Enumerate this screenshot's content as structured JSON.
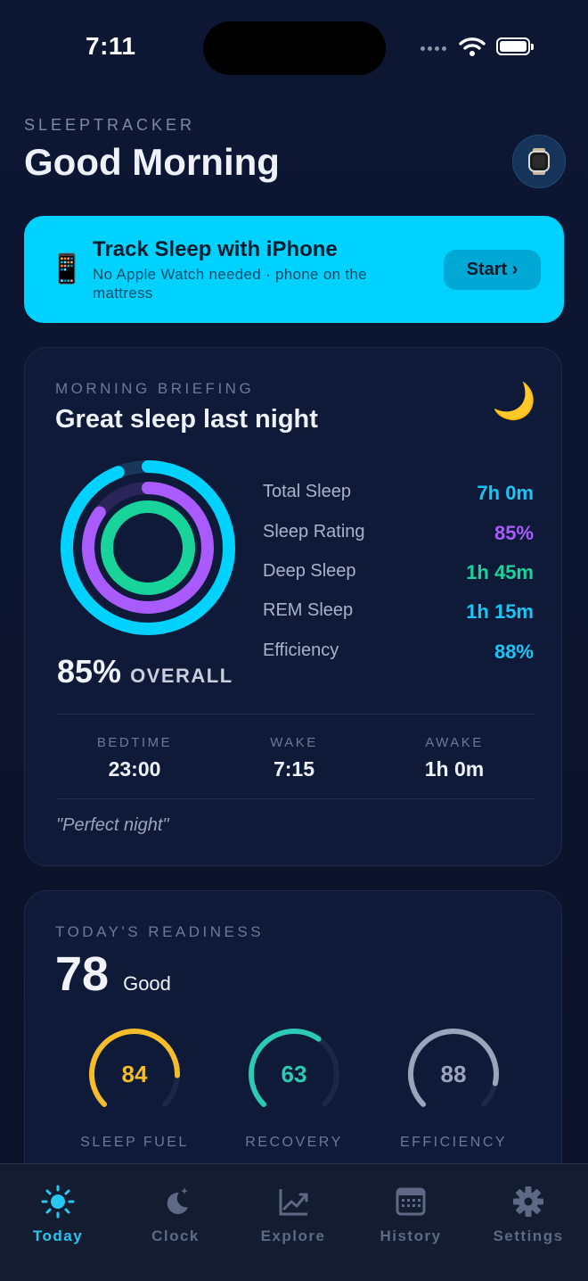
{
  "status_bar": {
    "time": "7:11"
  },
  "header": {
    "app_name": "SLEEPTRACKER",
    "greeting": "Good Morning"
  },
  "promo": {
    "title": "Track Sleep with iPhone",
    "subtitle": "No Apple Watch needed · phone on the mattress",
    "button": "Start ›"
  },
  "briefing": {
    "label": "MORNING BRIEFING",
    "title": "Great sleep last night",
    "overall_pct": "85%",
    "overall_label": "OVERALL",
    "stats": [
      {
        "name": "Total Sleep",
        "value": "7h 0m",
        "color": "#19c6f5"
      },
      {
        "name": "Sleep Rating",
        "value": "85%",
        "color": "#a95bff"
      },
      {
        "name": "Deep Sleep",
        "value": "1h 45m",
        "color": "#19d49a"
      },
      {
        "name": "REM Sleep",
        "value": "1h 15m",
        "color": "#19c6f5"
      },
      {
        "name": "Efficiency",
        "value": "88%",
        "color": "#19c6f5"
      }
    ],
    "times": [
      {
        "label": "BEDTIME",
        "value": "23:00"
      },
      {
        "label": "WAKE",
        "value": "7:15"
      },
      {
        "label": "AWAKE",
        "value": "1h 0m"
      }
    ],
    "quote": "\"Perfect night\"",
    "rings": [
      {
        "name": "outer",
        "fraction": 0.94,
        "color": "#00d2ff"
      },
      {
        "name": "middle",
        "fraction": 0.85,
        "color": "#a95bff"
      },
      {
        "name": "inner",
        "fraction": 1.0,
        "color": "#19d49a"
      }
    ]
  },
  "readiness": {
    "label": "TODAY'S READINESS",
    "score": "78",
    "rating": "Good",
    "gauges": [
      {
        "value": "84",
        "label": "SLEEP FUEL",
        "fraction": 0.84,
        "color": "#f5bd2a"
      },
      {
        "value": "63",
        "label": "RECOVERY",
        "fraction": 0.63,
        "color": "#2cc9b5"
      },
      {
        "value": "88",
        "label": "EFFICIENCY",
        "fraction": 0.88,
        "color": "#9aa5bb"
      }
    ]
  },
  "tabs": [
    {
      "label": "Today",
      "icon": "sun-icon",
      "active": true
    },
    {
      "label": "Clock",
      "icon": "moon-stars-icon"
    },
    {
      "label": "Explore",
      "icon": "chart-trend-icon"
    },
    {
      "label": "History",
      "icon": "calendar-icon"
    },
    {
      "label": "Settings",
      "icon": "gear-icon"
    }
  ]
}
